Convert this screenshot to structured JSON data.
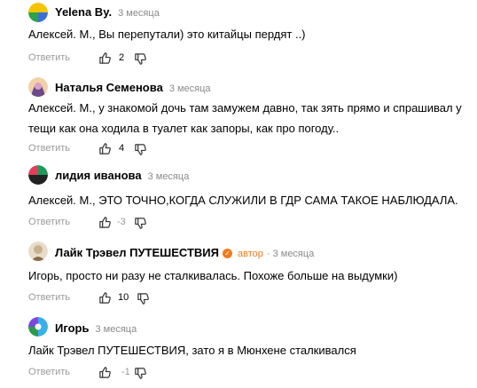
{
  "comments": [
    {
      "author": "Yelena By.",
      "time": "3 месяца",
      "is_author": false,
      "text": "Алексей. М., Вы перепутали) это китайцы пердят ..)",
      "reply_label": "Ответить",
      "likes": "2",
      "avatar_colors": [
        "#f5c400",
        "#2ca24a",
        "#3c6fd8"
      ]
    },
    {
      "author": "Наталья Семенова",
      "time": "3 месяца",
      "is_author": false,
      "text": "Алексей. М., у знакомой дочь там замужем давно, так зять прямо и спрашивал у тещи как она ходила в туалет как запоры, как про погоду..",
      "reply_label": "Ответить",
      "likes": "4",
      "avatar_colors": [
        "#f2d1a8",
        "#6b4a8a",
        "#d9a0c8"
      ]
    },
    {
      "author": "лидия иванова",
      "time": "3 месяца",
      "is_author": false,
      "text": "Алексей. М., ЭТО ТОЧНО,КОГДА СЛУЖИЛИ В ГДР САМА ТАКОЕ НАБЛЮДАЛА.",
      "reply_label": "Ответить",
      "likes": "-3",
      "avatar_colors": [
        "#e0405a",
        "#1e9a5a",
        "#222222"
      ]
    },
    {
      "author": "Лайк Трэвел ПУТЕШЕСТВИЯ",
      "time": "3 месяца",
      "is_author": true,
      "author_badge": "автор",
      "text": "Игорь, просто ни разу не сталкивалась. Похоже больше на выдумки)",
      "reply_label": "Ответить",
      "likes": "10",
      "avatar_colors": [
        "#c8b090",
        "#8a6a4a",
        "#e8dcc8"
      ]
    },
    {
      "author": "Игорь",
      "time": "3 месяца",
      "is_author": false,
      "text": "Лайк Трэвел ПУТЕШЕСТВИЯ, зато я в Мюнхене сталкивался",
      "reply_label": "Ответить",
      "likes": "-1",
      "avatar_colors": [
        "#7a4ae0",
        "#2c9a4a",
        "#3ab0e8"
      ]
    }
  ],
  "icons": {
    "like": "thumb-up-icon",
    "dislike": "thumb-down-icon",
    "verified": "verified-check-icon"
  }
}
